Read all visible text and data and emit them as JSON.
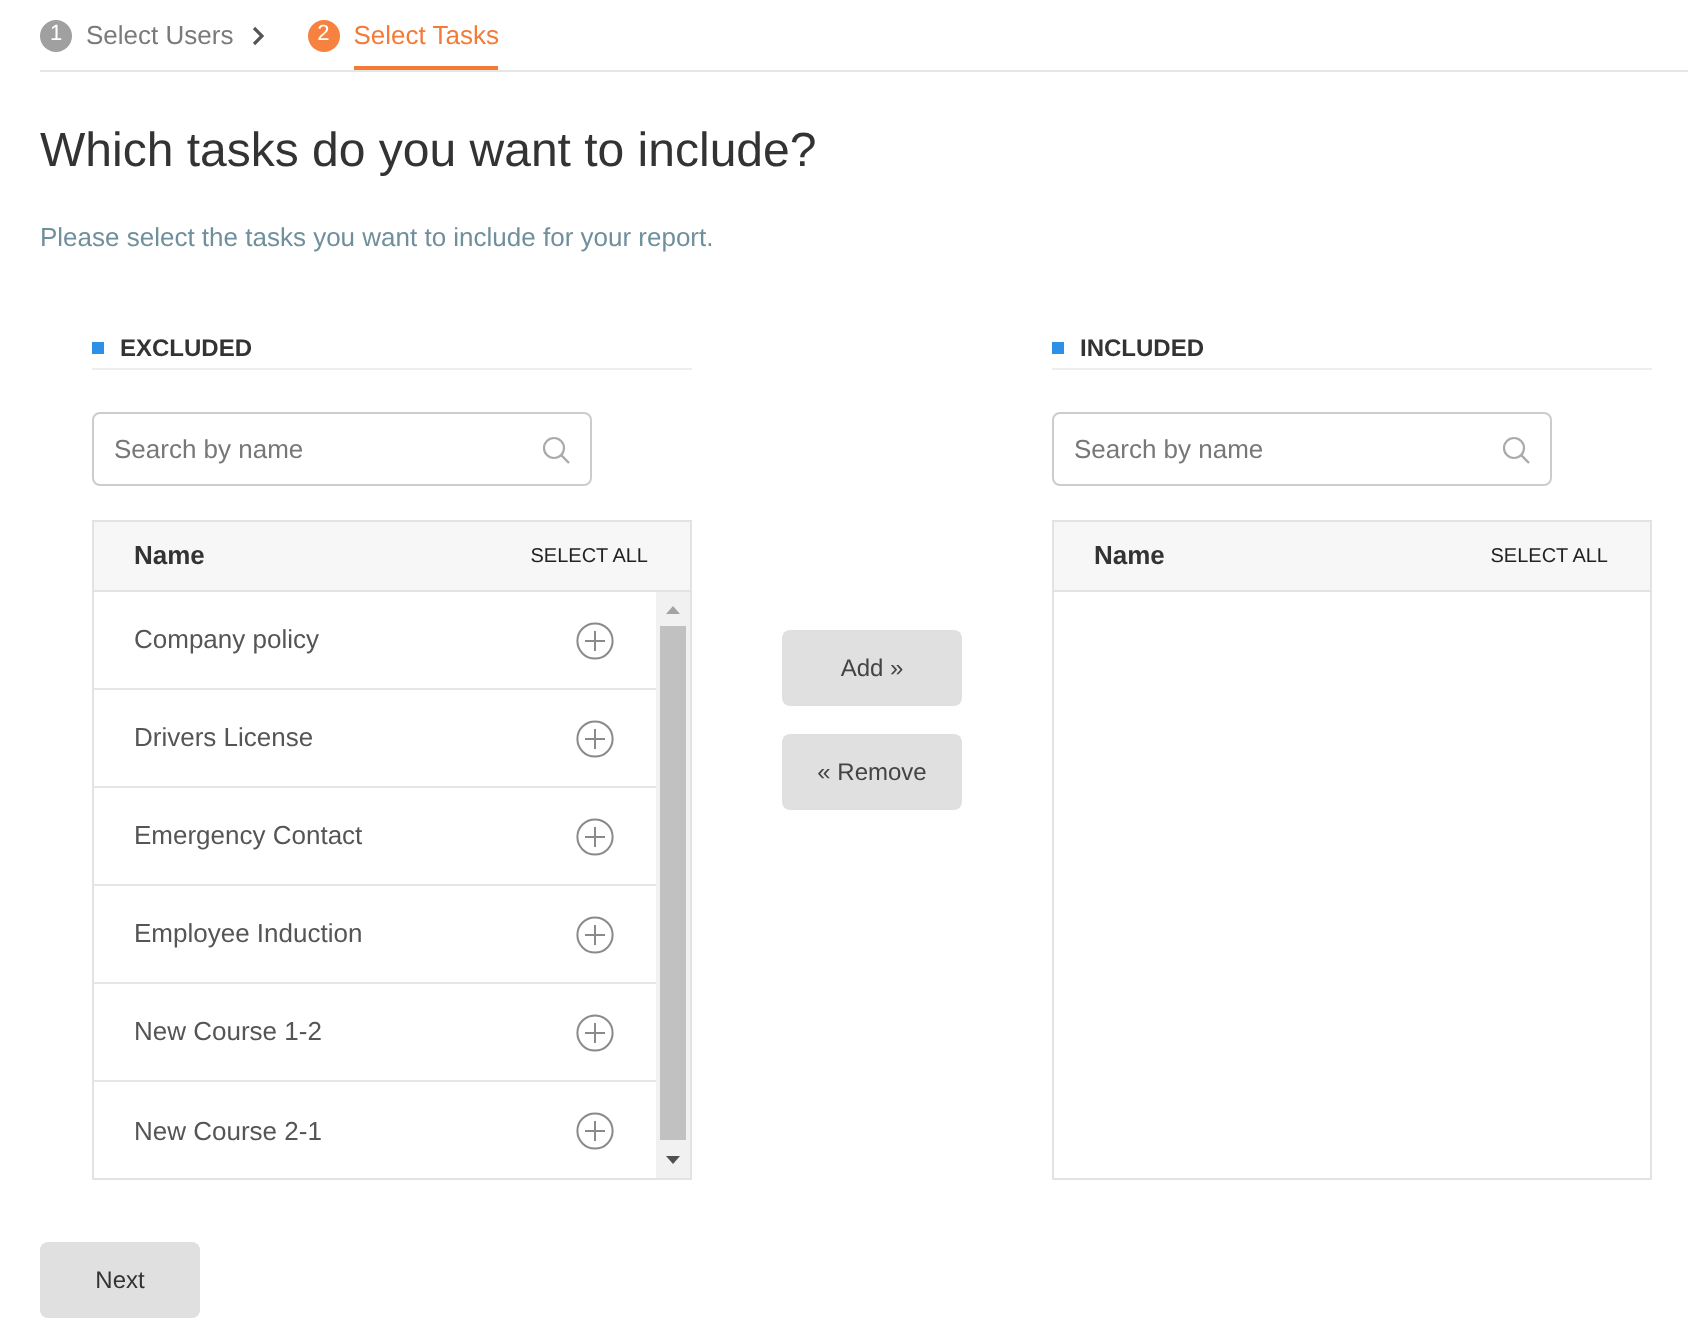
{
  "steps": [
    {
      "number": "1",
      "label": "Select Users",
      "selected": false
    },
    {
      "number": "2",
      "label": "Select Tasks",
      "selected": true
    }
  ],
  "title": "Which tasks do you want to include?",
  "subtitle": "Please select the tasks you want to include for your report.",
  "excluded": {
    "heading": "EXCLUDED",
    "search": {
      "placeholder": "Search by name"
    },
    "table": {
      "columns": [
        "Name"
      ],
      "select_all": "SELECT ALL",
      "rows": [
        "Company policy",
        "Drivers License",
        "Emergency Contact",
        "Employee Induction",
        "New Course 1-2",
        "New Course 2-1"
      ]
    }
  },
  "actions": [
    {
      "label": "Add »"
    },
    {
      "label": "« Remove"
    }
  ],
  "included": {
    "heading": "INCLUDED",
    "search": {
      "placeholder": "Search by name"
    },
    "table": {
      "columns": [
        "Name"
      ],
      "select_all": "SELECT ALL"
    }
  },
  "next_button": {
    "label": "Next"
  }
}
